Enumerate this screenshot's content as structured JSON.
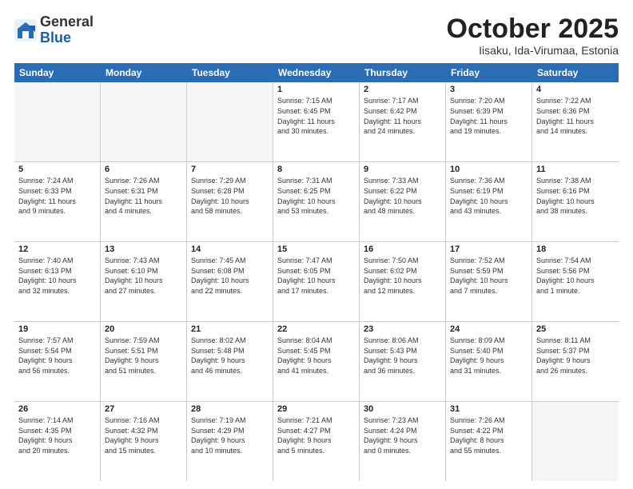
{
  "header": {
    "logo_general": "General",
    "logo_blue": "Blue",
    "month_title": "October 2025",
    "location": "Iisaku, Ida-Virumaa, Estonia"
  },
  "weekdays": [
    "Sunday",
    "Monday",
    "Tuesday",
    "Wednesday",
    "Thursday",
    "Friday",
    "Saturday"
  ],
  "rows": [
    [
      {
        "day": "",
        "info": ""
      },
      {
        "day": "",
        "info": ""
      },
      {
        "day": "",
        "info": ""
      },
      {
        "day": "1",
        "info": "Sunrise: 7:15 AM\nSunset: 6:45 PM\nDaylight: 11 hours\nand 30 minutes."
      },
      {
        "day": "2",
        "info": "Sunrise: 7:17 AM\nSunset: 6:42 PM\nDaylight: 11 hours\nand 24 minutes."
      },
      {
        "day": "3",
        "info": "Sunrise: 7:20 AM\nSunset: 6:39 PM\nDaylight: 11 hours\nand 19 minutes."
      },
      {
        "day": "4",
        "info": "Sunrise: 7:22 AM\nSunset: 6:36 PM\nDaylight: 11 hours\nand 14 minutes."
      }
    ],
    [
      {
        "day": "5",
        "info": "Sunrise: 7:24 AM\nSunset: 6:33 PM\nDaylight: 11 hours\nand 9 minutes."
      },
      {
        "day": "6",
        "info": "Sunrise: 7:26 AM\nSunset: 6:31 PM\nDaylight: 11 hours\nand 4 minutes."
      },
      {
        "day": "7",
        "info": "Sunrise: 7:29 AM\nSunset: 6:28 PM\nDaylight: 10 hours\nand 58 minutes."
      },
      {
        "day": "8",
        "info": "Sunrise: 7:31 AM\nSunset: 6:25 PM\nDaylight: 10 hours\nand 53 minutes."
      },
      {
        "day": "9",
        "info": "Sunrise: 7:33 AM\nSunset: 6:22 PM\nDaylight: 10 hours\nand 48 minutes."
      },
      {
        "day": "10",
        "info": "Sunrise: 7:36 AM\nSunset: 6:19 PM\nDaylight: 10 hours\nand 43 minutes."
      },
      {
        "day": "11",
        "info": "Sunrise: 7:38 AM\nSunset: 6:16 PM\nDaylight: 10 hours\nand 38 minutes."
      }
    ],
    [
      {
        "day": "12",
        "info": "Sunrise: 7:40 AM\nSunset: 6:13 PM\nDaylight: 10 hours\nand 32 minutes."
      },
      {
        "day": "13",
        "info": "Sunrise: 7:43 AM\nSunset: 6:10 PM\nDaylight: 10 hours\nand 27 minutes."
      },
      {
        "day": "14",
        "info": "Sunrise: 7:45 AM\nSunset: 6:08 PM\nDaylight: 10 hours\nand 22 minutes."
      },
      {
        "day": "15",
        "info": "Sunrise: 7:47 AM\nSunset: 6:05 PM\nDaylight: 10 hours\nand 17 minutes."
      },
      {
        "day": "16",
        "info": "Sunrise: 7:50 AM\nSunset: 6:02 PM\nDaylight: 10 hours\nand 12 minutes."
      },
      {
        "day": "17",
        "info": "Sunrise: 7:52 AM\nSunset: 5:59 PM\nDaylight: 10 hours\nand 7 minutes."
      },
      {
        "day": "18",
        "info": "Sunrise: 7:54 AM\nSunset: 5:56 PM\nDaylight: 10 hours\nand 1 minute."
      }
    ],
    [
      {
        "day": "19",
        "info": "Sunrise: 7:57 AM\nSunset: 5:54 PM\nDaylight: 9 hours\nand 56 minutes."
      },
      {
        "day": "20",
        "info": "Sunrise: 7:59 AM\nSunset: 5:51 PM\nDaylight: 9 hours\nand 51 minutes."
      },
      {
        "day": "21",
        "info": "Sunrise: 8:02 AM\nSunset: 5:48 PM\nDaylight: 9 hours\nand 46 minutes."
      },
      {
        "day": "22",
        "info": "Sunrise: 8:04 AM\nSunset: 5:45 PM\nDaylight: 9 hours\nand 41 minutes."
      },
      {
        "day": "23",
        "info": "Sunrise: 8:06 AM\nSunset: 5:43 PM\nDaylight: 9 hours\nand 36 minutes."
      },
      {
        "day": "24",
        "info": "Sunrise: 8:09 AM\nSunset: 5:40 PM\nDaylight: 9 hours\nand 31 minutes."
      },
      {
        "day": "25",
        "info": "Sunrise: 8:11 AM\nSunset: 5:37 PM\nDaylight: 9 hours\nand 26 minutes."
      }
    ],
    [
      {
        "day": "26",
        "info": "Sunrise: 7:14 AM\nSunset: 4:35 PM\nDaylight: 9 hours\nand 20 minutes."
      },
      {
        "day": "27",
        "info": "Sunrise: 7:16 AM\nSunset: 4:32 PM\nDaylight: 9 hours\nand 15 minutes."
      },
      {
        "day": "28",
        "info": "Sunrise: 7:19 AM\nSunset: 4:29 PM\nDaylight: 9 hours\nand 10 minutes."
      },
      {
        "day": "29",
        "info": "Sunrise: 7:21 AM\nSunset: 4:27 PM\nDaylight: 9 hours\nand 5 minutes."
      },
      {
        "day": "30",
        "info": "Sunrise: 7:23 AM\nSunset: 4:24 PM\nDaylight: 9 hours\nand 0 minutes."
      },
      {
        "day": "31",
        "info": "Sunrise: 7:26 AM\nSunset: 4:22 PM\nDaylight: 8 hours\nand 55 minutes."
      },
      {
        "day": "",
        "info": ""
      }
    ]
  ]
}
